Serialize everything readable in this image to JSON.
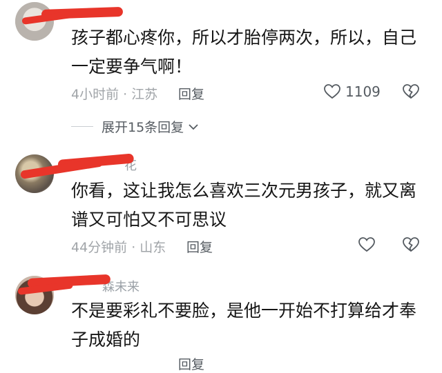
{
  "comments": [
    {
      "name": "",
      "text": "孩子都心疼你，所以才胎停两次，所以，自己一定要争气啊！",
      "meta": "4小时前 · 江苏",
      "reply_label": "回复",
      "like_count": "1109",
      "expand_label": "展开15条回复"
    },
    {
      "name": "花",
      "text": "你看，这让我怎么喜欢三次元男孩子，就又离谱又可怕又不可思议",
      "meta": "44分钟前 · 山东",
      "reply_label": "回复",
      "like_count": ""
    },
    {
      "name": "森未来",
      "text": "不是要彩礼不要脸，是他一开始不打算给才奉子成婚的",
      "meta": "",
      "reply_label": "回复",
      "like_count": ""
    }
  ],
  "colors": {
    "redaction": "#e8352a",
    "meta_text": "#a0a4a8",
    "body_text": "#161616"
  },
  "icons": {
    "like": "heart-icon",
    "dislike": "broken-heart-icon",
    "expand": "chevron-down-icon"
  }
}
